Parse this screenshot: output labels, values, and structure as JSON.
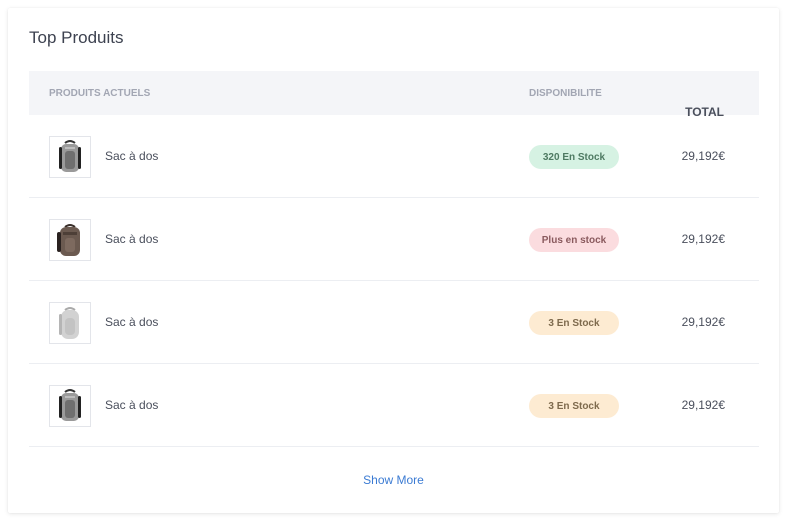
{
  "card": {
    "title": "Top Produits"
  },
  "table": {
    "headers": {
      "product": "PRODUITS ACTUELS",
      "availability": "DISPONIBILITE",
      "total": "TOTAL"
    },
    "rows": [
      {
        "name": "Sac à dos",
        "availability": "320 En Stock",
        "status": "green",
        "total": "29,192€",
        "image": "backpack-grey-black-icon"
      },
      {
        "name": "Sac à dos",
        "availability": "Plus en stock",
        "status": "red",
        "total": "29,192€",
        "image": "backpack-brown-icon"
      },
      {
        "name": "Sac à dos",
        "availability": "3 En Stock",
        "status": "orange",
        "total": "29,192€",
        "image": "backpack-light-grey-icon"
      },
      {
        "name": "Sac à dos",
        "availability": "3 En Stock",
        "status": "orange",
        "total": "29,192€",
        "image": "backpack-grey-black-icon"
      }
    ]
  },
  "footer": {
    "show_more": "Show More"
  },
  "colors": {
    "in_stock": "#d6f2e3",
    "out_of_stock": "#fbdcdf",
    "low_stock": "#fdebd2",
    "link": "#3b7bd3"
  }
}
